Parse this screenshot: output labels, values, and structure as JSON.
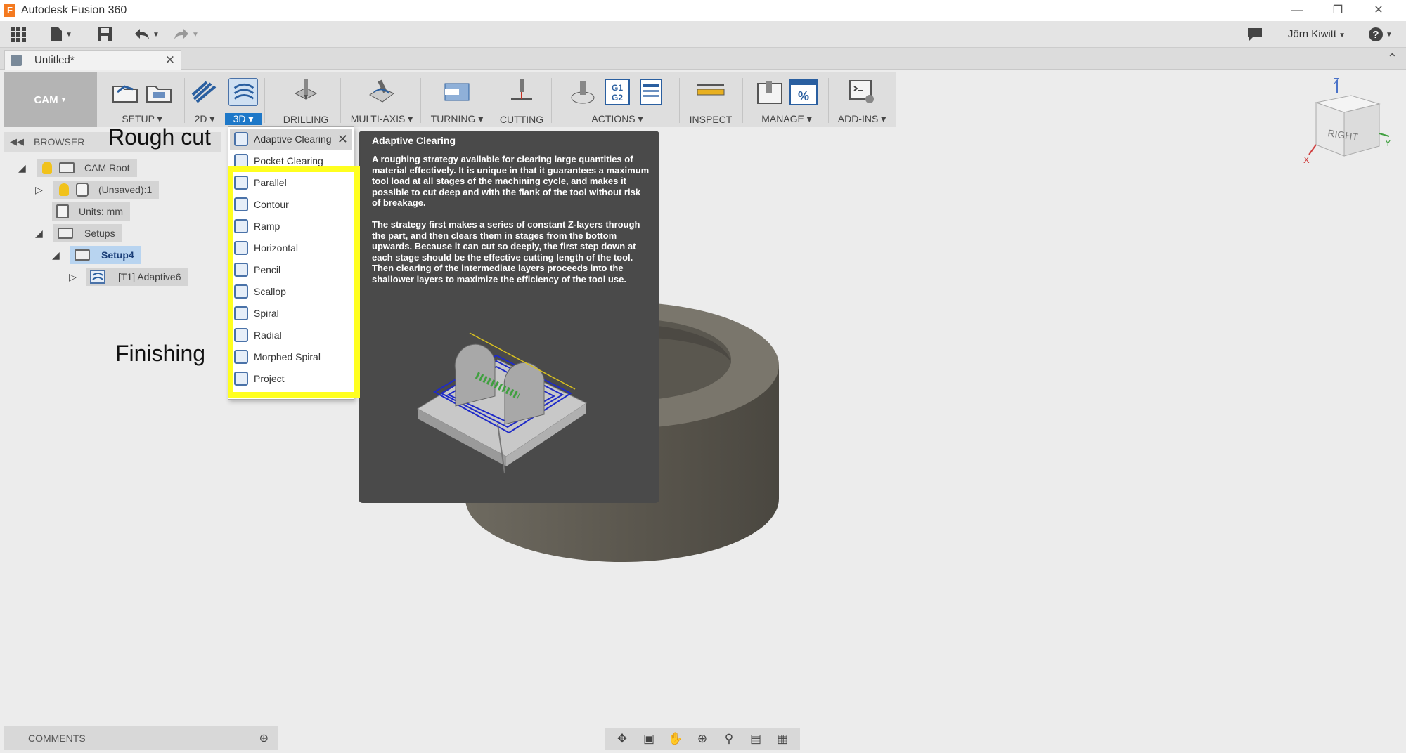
{
  "window": {
    "title": "Autodesk Fusion 360",
    "app_icon_letter": "F"
  },
  "qat": {
    "user_name": "Jörn Kiwitt"
  },
  "tabs": [
    {
      "label": "Untitled*"
    }
  ],
  "ribbon": {
    "workspace": "CAM",
    "groups": [
      {
        "label": "SETUP"
      },
      {
        "label": "2D"
      },
      {
        "label": "3D"
      },
      {
        "label": "DRILLING"
      },
      {
        "label": "MULTI-AXIS"
      },
      {
        "label": "TURNING"
      },
      {
        "label": "CUTTING"
      },
      {
        "label": "ACTIONS"
      },
      {
        "label": "INSPECT"
      },
      {
        "label": "MANAGE"
      },
      {
        "label": "ADD-INS"
      }
    ],
    "g1g2_text": [
      "G1",
      "G2"
    ],
    "percent_text": "%"
  },
  "browser": {
    "title": "BROWSER",
    "nodes": [
      {
        "label": "CAM Root"
      },
      {
        "label": "(Unsaved):1"
      },
      {
        "label": "Units: mm"
      },
      {
        "label": "Setups"
      },
      {
        "label": "Setup4"
      },
      {
        "label": "[T1] Adaptive6"
      }
    ]
  },
  "annotations": {
    "rough_cut": "Rough cut",
    "finishing": "Finishing"
  },
  "dropdown": {
    "items": [
      {
        "label": "Adaptive Clearing"
      },
      {
        "label": "Pocket Clearing"
      },
      {
        "label": "Parallel"
      },
      {
        "label": "Contour"
      },
      {
        "label": "Ramp"
      },
      {
        "label": "Horizontal"
      },
      {
        "label": "Pencil"
      },
      {
        "label": "Scallop"
      },
      {
        "label": "Spiral"
      },
      {
        "label": "Radial"
      },
      {
        "label": "Morphed Spiral"
      },
      {
        "label": "Project"
      }
    ]
  },
  "tooltip": {
    "title": "Adaptive Clearing",
    "p1": "A roughing strategy available for clearing large quantities of material effectively. It is unique in that it guarantees a maximum tool load at all stages of the machining cycle, and makes it possible to cut deep and with the flank of the tool without risk of breakage.",
    "p2": "The strategy first makes a series of constant Z-layers through the part, and then clears them in stages from the bottom upwards. Because it can cut so deeply, the first step down at each stage should be the effective cutting length of the tool. Then clearing of the intermediate layers proceeds into the shallower layers to maximize the efficiency of the tool use."
  },
  "viewcube": {
    "face": "RIGHT",
    "axes": {
      "z": "Z",
      "y": "Y",
      "x": "X"
    }
  },
  "comments": {
    "label": "COMMENTS"
  },
  "colors": {
    "highlight": "#ffff1f",
    "tooltip_bg": "#4a4a4a",
    "selected": "#b8d4f0",
    "active_tab": "#1e78c8"
  }
}
